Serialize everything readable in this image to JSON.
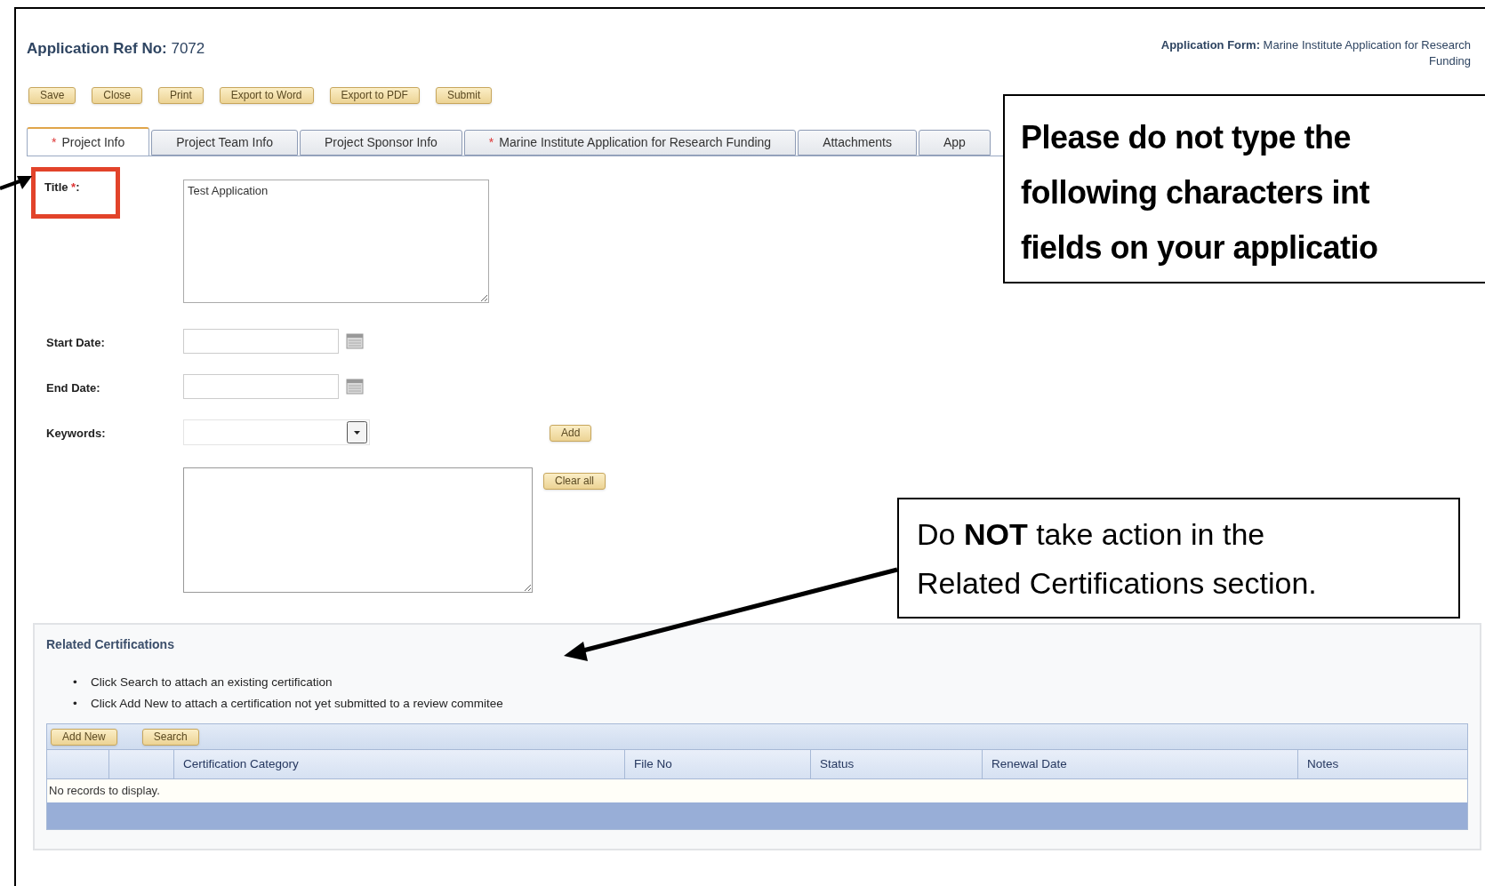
{
  "header": {
    "ref": "**Application Ref No:** 7072",
    "form": "**Application Form:** Marine Institute Application for Research Funding"
  },
  "toolbar": [
    "Save",
    "Close",
    "Print",
    "Export to Word",
    "Export to PDF",
    "Submit"
  ],
  "tabs": [
    {
      "label": "Project Info",
      "required_mark": "*",
      "selected": true
    },
    {
      "label": "Project Team Info",
      "selected": false
    },
    {
      "label": "Project Sponsor Info",
      "selected": false
    },
    {
      "label": "Marine Institute Application for Research Funding",
      "required_mark": "*",
      "selected": false
    },
    {
      "label": "Attachments",
      "selected": false
    },
    {
      "label": "App",
      "selected": false
    }
  ],
  "form": {
    "title": {
      "label": "Title",
      "required_mark": "*",
      "colon": ":",
      "value": "Test Application",
      "highlighted": true
    },
    "start_date": {
      "label": "Start Date:"
    },
    "end_date": {
      "label": "End Date:"
    },
    "keywords": {
      "label": "Keywords:",
      "add_button": "Add",
      "clear_button": "Clear all"
    }
  },
  "related_certifications": {
    "title": "Related Certifications",
    "instructions": [
      {
        "bullet": "•",
        "text": "Click Search to attach an existing certification"
      },
      {
        "bullet": "•",
        "text": "Click Add New to attach a certification not yet submitted to a review commitee"
      }
    ],
    "buttons": [
      "Add New",
      "Search"
    ],
    "columns": [
      "Certification Category",
      "File No",
      "Status",
      "Renewal Date",
      "Notes"
    ],
    "empty_message": "No records to display."
  },
  "callouts": [
    {
      "kind": "bold",
      "text": "Please do not type the\nfollowing characters int\nfields on your applicatio"
    },
    {
      "kind": "plain",
      "text": "Do **NOT** take action in the\nRelated Certifications section."
    }
  ]
}
